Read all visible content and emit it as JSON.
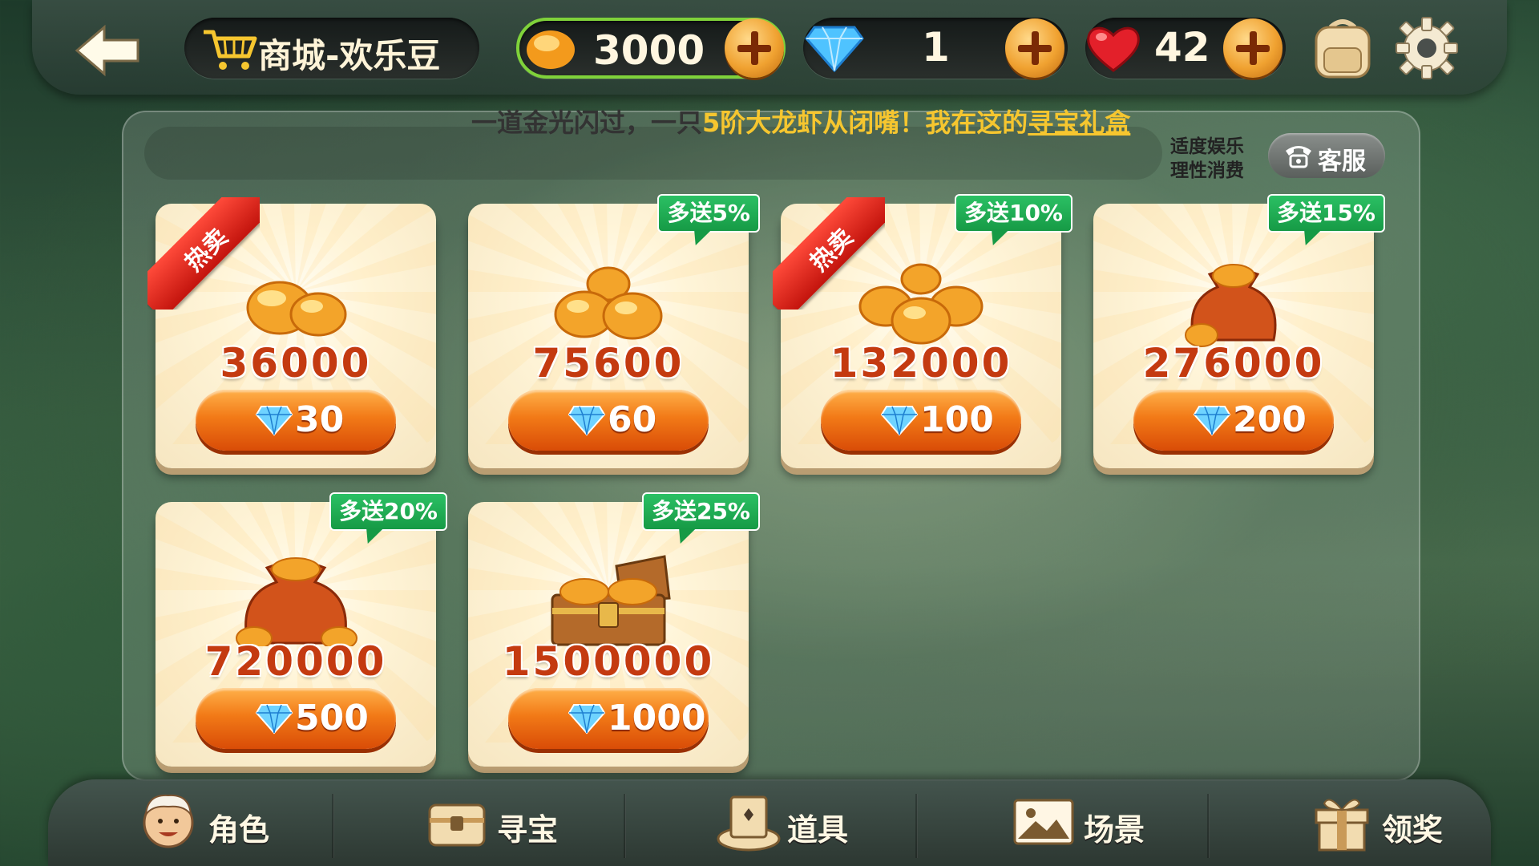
{
  "header": {
    "title": "商城-欢乐豆",
    "beans": "3000",
    "gems": "1",
    "hearts": "42"
  },
  "marquee": {
    "prefix": "一道金光闪过，一只",
    "highlight": "5阶大龙虾从闭嘴！",
    "middle": "我在这的",
    "link": "寻宝礼盒"
  },
  "notice": {
    "line1": "适度娱乐",
    "line2": "理性消费"
  },
  "service_label": "客服",
  "hot_label": "热卖",
  "products": [
    {
      "amount": "36000",
      "price": "30",
      "bonus": "",
      "hot": true,
      "art": "beans-small"
    },
    {
      "amount": "75600",
      "price": "60",
      "bonus": "多送5%",
      "hot": false,
      "art": "beans-medium"
    },
    {
      "amount": "132000",
      "price": "100",
      "bonus": "多送10%",
      "hot": true,
      "art": "beans-pile"
    },
    {
      "amount": "276000",
      "price": "200",
      "bonus": "多送15%",
      "hot": false,
      "art": "bean-bag-small"
    },
    {
      "amount": "720000",
      "price": "500",
      "bonus": "多送20%",
      "hot": false,
      "art": "bean-bag-large"
    },
    {
      "amount": "1500000",
      "price": "1000",
      "bonus": "多送25%",
      "hot": false,
      "art": "treasure-chest"
    }
  ],
  "nav": [
    {
      "label": "角色",
      "icon": "character-icon"
    },
    {
      "label": "寻宝",
      "icon": "treasure-icon"
    },
    {
      "label": "道具",
      "icon": "hat-icon"
    },
    {
      "label": "场景",
      "icon": "scene-icon"
    },
    {
      "label": "领奖",
      "icon": "gift-icon"
    }
  ],
  "colors": {
    "accent_orange": "#f27a17",
    "bonus_green": "#169a45",
    "hot_red": "#c3140d",
    "amount_red": "#c43a10"
  }
}
